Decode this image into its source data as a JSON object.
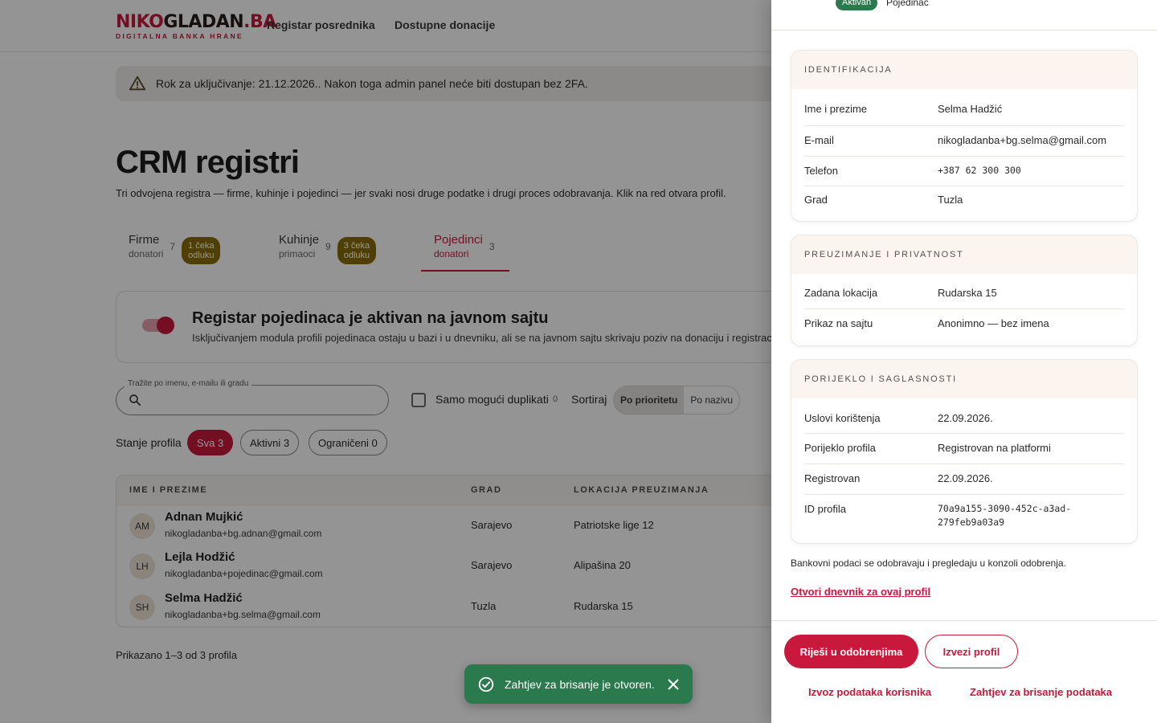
{
  "header": {
    "logo_part1": "NIKO",
    "logo_part2": "GLADAN",
    "logo_part3": ".BA",
    "logo_sub": "DIGITALNA BANKA HRANE",
    "nav": [
      "Registar posrednika",
      "Dostupne donacije"
    ]
  },
  "alert": {
    "icon": "warning-icon",
    "text": "Rok za uključivanje: 21.12.2026.. Nakon toga admin panel neće biti dostupan bez 2FA."
  },
  "page": {
    "title": "CRM registri",
    "subtitle": "Tri odvojena registra — firme, kuhinje i pojedinci — jer svaki nosi druge podatke i drugi proces odobravanja. Klik na red otvara profil."
  },
  "tabs": [
    {
      "label": "Firme",
      "sub": "donatori",
      "count": "7",
      "badge": "1 čeka odluku"
    },
    {
      "label": "Kuhinje",
      "sub": "primaoci",
      "count": "9",
      "badge": "3 čeka odluku"
    },
    {
      "label": "Pojedinci",
      "sub": "donatori",
      "count": "3",
      "badge": ""
    }
  ],
  "module": {
    "title": "Registar pojedinaca je aktivan na javnom sajtu",
    "desc": "Isključivanjem modula profili pojedinaca ostaju u bazi i u dnevniku, ali se na javnom sajtu skrivaju poziv na donaciju i registracija."
  },
  "filters": {
    "search_label": "Tražite po imenu, e-mailu ili gradu",
    "search_value": "",
    "dup_label": "Samo mogući duplikati",
    "dup_count": "0",
    "sort_label": "Sortiraj",
    "sort_options": [
      "Po prioritetu",
      "Po nazivu"
    ],
    "state_label": "Stanje profila",
    "chips": [
      "Sva 3",
      "Aktivni 3",
      "Ograničeni 0"
    ]
  },
  "table": {
    "headers": [
      "IME I PREZIME",
      "GRAD",
      "LOKACIJA PREUZIMANJA"
    ],
    "rows": [
      {
        "initials": "AM",
        "name": "Adnan Mujkić",
        "email": "nikogladanba+bg.adnan@gmail.com",
        "city": "Sarajevo",
        "location": "Patriotske lige 12"
      },
      {
        "initials": "LH",
        "name": "Lejla Hodžić",
        "email": "nikogladanba+pojedinac@gmail.com",
        "city": "Sarajevo",
        "location": "Alipašina 20"
      },
      {
        "initials": "SH",
        "name": "Selma Hadžić",
        "email": "nikogladanba+bg.selma@gmail.com",
        "city": "Tuzla",
        "location": "Rudarska 15"
      }
    ],
    "footer": "Prikazano 1–3 od 3 profila"
  },
  "toast": {
    "icon": "check-circle-icon",
    "text": "Zahtjev za brisanje je otvoren."
  },
  "drawer": {
    "status": "Aktivan",
    "type": "Pojedinac",
    "sections": [
      {
        "title": "IDENTIFIKACIJA",
        "rows": [
          {
            "key": "Ime i prezime",
            "value": "Selma Hadžić"
          },
          {
            "key": "E-mail",
            "value": "nikogladanba+bg.selma@gmail.com"
          },
          {
            "key": "Telefon",
            "value": "+387 62 300 300"
          },
          {
            "key": "Grad",
            "value": "Tuzla"
          }
        ]
      },
      {
        "title": "PREUZIMANJE I PRIVATNOST",
        "rows": [
          {
            "key": "Zadana lokacija",
            "value": "Rudarska 15"
          },
          {
            "key": "Prikaz na sajtu",
            "value": "Anonimno — bez imena"
          }
        ]
      },
      {
        "title": "PORIJEKLO I SAGLASNOSTI",
        "rows": [
          {
            "key": "Uslovi korištenja",
            "value": "22.09.2026."
          },
          {
            "key": "Porijeklo profila",
            "value": "Registrovan na platformi"
          },
          {
            "key": "Registrovan",
            "value": "22.09.2026."
          },
          {
            "key": "ID profila",
            "value": "70a9a155-3090-452c-a3ad-279feb9a03a9"
          }
        ]
      }
    ],
    "bank_note": "Bankovni podaci se odobravaju i pregledaju u konzoli odobrenja.",
    "journal_link": "Otvori dnevnik za ovaj profil",
    "actions": {
      "resolve": "Riješi u odobrenjima",
      "export_profile": "Izvezi profil",
      "export_data": "Izvoz podataka korisnika",
      "delete_request": "Zahtjev za brisanje podataka"
    }
  },
  "colors": {
    "brand": "#c8193c",
    "success": "#2b7a4e",
    "badge": "#8a6d0a"
  }
}
